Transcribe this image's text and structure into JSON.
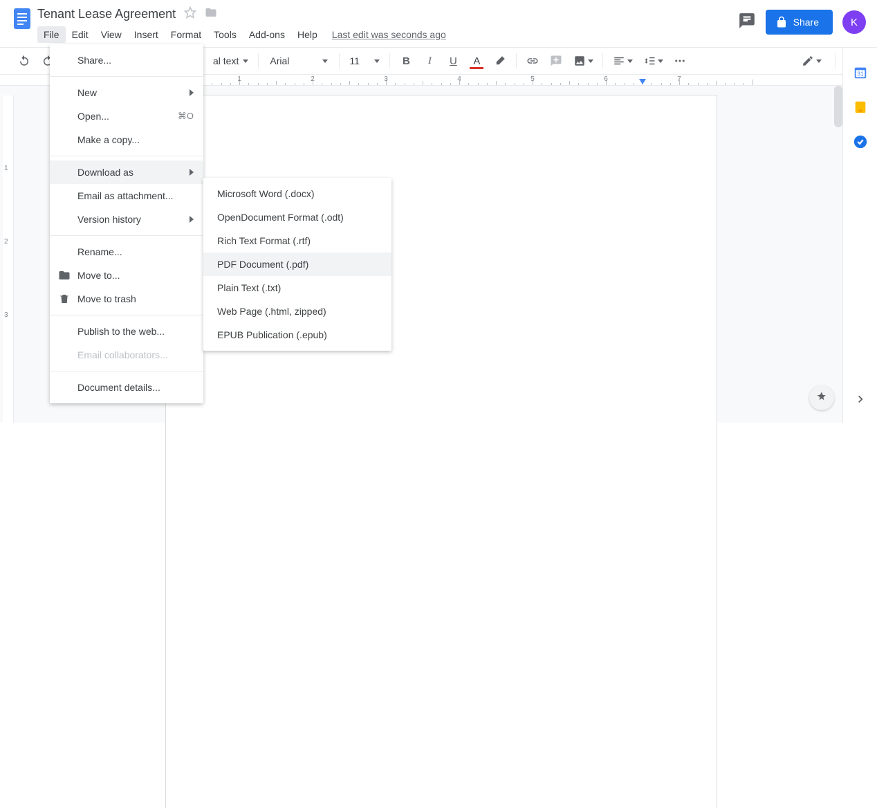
{
  "header": {
    "title": "Tenant Lease Agreement",
    "menus": [
      "File",
      "Edit",
      "View",
      "Insert",
      "Format",
      "Tools",
      "Add-ons",
      "Help"
    ],
    "last_edit": "Last edit was seconds ago",
    "share_label": "Share",
    "avatar_initial": "K"
  },
  "toolbar": {
    "styles": "al text",
    "font": "Arial",
    "size": "11"
  },
  "ruler": {
    "labels": [
      "1",
      "2",
      "3",
      "4",
      "5",
      "6",
      "7"
    ]
  },
  "file_menu": {
    "items": [
      {
        "label": "Share...",
        "type": "item"
      },
      {
        "type": "divider"
      },
      {
        "label": "New",
        "type": "submenu"
      },
      {
        "label": "Open...",
        "shortcut": "⌘O",
        "type": "item"
      },
      {
        "label": "Make a copy...",
        "type": "item"
      },
      {
        "type": "divider"
      },
      {
        "label": "Download as",
        "type": "submenu",
        "hover": true
      },
      {
        "label": "Email as attachment...",
        "type": "item"
      },
      {
        "label": "Version history",
        "type": "submenu"
      },
      {
        "type": "divider"
      },
      {
        "label": "Rename...",
        "type": "item"
      },
      {
        "label": "Move to...",
        "type": "item",
        "icon": "folder"
      },
      {
        "label": "Move to trash",
        "type": "item",
        "icon": "trash"
      },
      {
        "type": "divider"
      },
      {
        "label": "Publish to the web...",
        "type": "item"
      },
      {
        "label": "Email collaborators...",
        "type": "item",
        "disabled": true
      },
      {
        "type": "divider"
      },
      {
        "label": "Document details...",
        "type": "item"
      }
    ]
  },
  "download_submenu": {
    "items": [
      {
        "label": "Microsoft Word (.docx)"
      },
      {
        "label": "OpenDocument Format (.odt)"
      },
      {
        "label": "Rich Text Format (.rtf)"
      },
      {
        "label": "PDF Document (.pdf)",
        "hover": true
      },
      {
        "label": "Plain Text (.txt)"
      },
      {
        "label": "Web Page (.html, zipped)"
      },
      {
        "label": "EPUB Publication (.epub)"
      }
    ]
  }
}
